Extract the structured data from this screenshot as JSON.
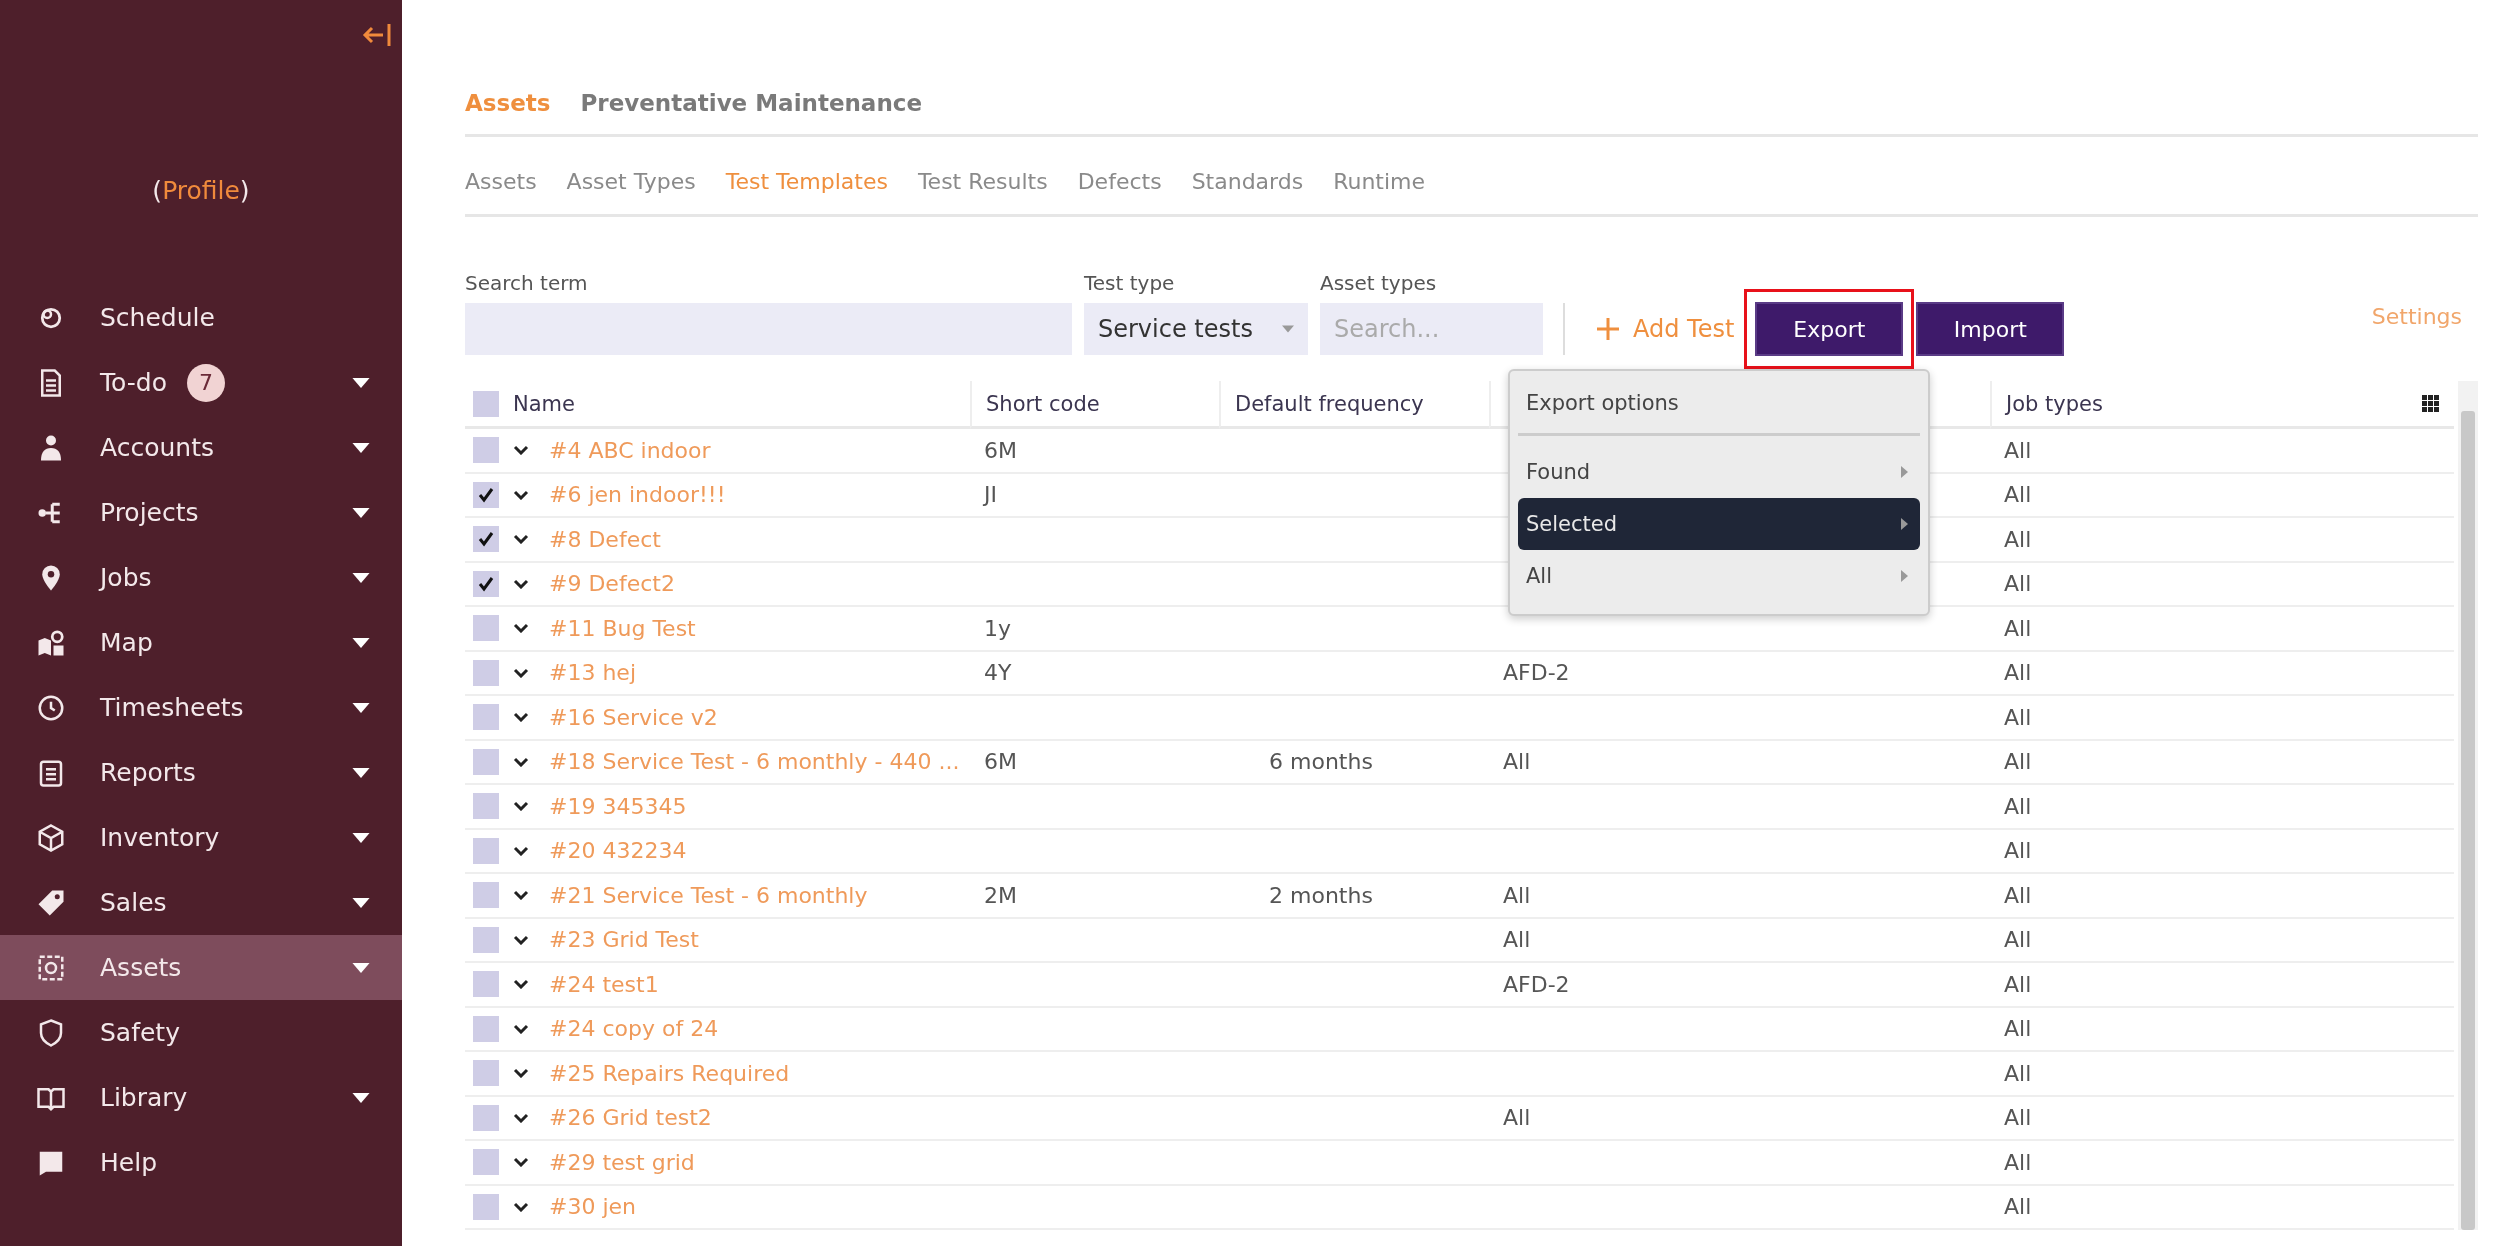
{
  "sidebar": {
    "profile": {
      "prefix": "(",
      "link": "Profile",
      "suffix": ")"
    },
    "items": [
      {
        "label": "Schedule",
        "expandable": false,
        "selected": false
      },
      {
        "label": "To-do",
        "badge": "7",
        "expandable": true,
        "selected": false
      },
      {
        "label": "Accounts",
        "expandable": true,
        "selected": false
      },
      {
        "label": "Projects",
        "expandable": true,
        "selected": false
      },
      {
        "label": "Jobs",
        "expandable": true,
        "selected": false
      },
      {
        "label": "Map",
        "expandable": true,
        "selected": false
      },
      {
        "label": "Timesheets",
        "expandable": true,
        "selected": false
      },
      {
        "label": "Reports",
        "expandable": true,
        "selected": false
      },
      {
        "label": "Inventory",
        "expandable": true,
        "selected": false
      },
      {
        "label": "Sales",
        "expandable": true,
        "selected": false
      },
      {
        "label": "Assets",
        "expandable": true,
        "selected": true
      },
      {
        "label": "Safety",
        "expandable": false,
        "selected": false
      },
      {
        "label": "Library",
        "expandable": true,
        "selected": false
      },
      {
        "label": "Help",
        "expandable": false,
        "selected": false
      }
    ]
  },
  "section_tabs": [
    {
      "label": "Assets",
      "selected": true
    },
    {
      "label": "Preventative Maintenance",
      "selected": false
    }
  ],
  "sub_tabs": [
    {
      "label": "Assets",
      "selected": false
    },
    {
      "label": "Asset Types",
      "selected": false
    },
    {
      "label": "Test Templates",
      "selected": true
    },
    {
      "label": "Test Results",
      "selected": false
    },
    {
      "label": "Defects",
      "selected": false
    },
    {
      "label": "Standards",
      "selected": false
    },
    {
      "label": "Runtime",
      "selected": false
    }
  ],
  "filters": {
    "search_term": {
      "label": "Search term"
    },
    "test_type": {
      "label": "Test type",
      "value": "Service tests"
    },
    "asset_types": {
      "label": "Asset types",
      "placeholder": "Search..."
    }
  },
  "toolbar": {
    "add_test": "Add Test",
    "export": "Export",
    "import": "Import",
    "settings": "Settings"
  },
  "export_menu": {
    "title": "Export options",
    "items": [
      {
        "label": "Found",
        "selected": false
      },
      {
        "label": "Selected",
        "selected": true
      },
      {
        "label": "All",
        "selected": false
      }
    ]
  },
  "table": {
    "columns": [
      "Name",
      "Short code",
      "Default frequency",
      "Job types"
    ],
    "header_checked": false,
    "rows": [
      {
        "checked": false,
        "name": "#4 ABC indoor",
        "short_code": "6M",
        "job_types": "All"
      },
      {
        "checked": true,
        "name": "#6 jen indoor!!!",
        "short_code": "JI",
        "job_types": "All"
      },
      {
        "checked": true,
        "name": "#8 Defect",
        "job_types": "All"
      },
      {
        "checked": true,
        "name": "#9 Defect2",
        "job_types": "All"
      },
      {
        "checked": false,
        "name": "#11 Bug Test",
        "short_code": "1y",
        "job_types": "All"
      },
      {
        "checked": false,
        "name": "#13 hej",
        "short_code": "4Y",
        "column_4": "AFD-2",
        "job_types": "All"
      },
      {
        "checked": false,
        "name": "#16 Service v2",
        "job_types": "All"
      },
      {
        "checked": false,
        "name": "#18 Service Test - 6 monthly - 440 ...",
        "short_code": "6M",
        "default_frequency": "6 months",
        "column_4": "All",
        "job_types": "All"
      },
      {
        "checked": false,
        "name": "#19 345345",
        "job_types": "All"
      },
      {
        "checked": false,
        "name": "#20 432234",
        "job_types": "All"
      },
      {
        "checked": false,
        "name": "#21 Service Test - 6 monthly",
        "short_code": "2M",
        "default_frequency": "2 months",
        "column_4": "All",
        "job_types": "All"
      },
      {
        "checked": false,
        "name": "#23 Grid Test",
        "column_4": "All",
        "job_types": "All"
      },
      {
        "checked": false,
        "name": "#24 test1",
        "column_4": "AFD-2",
        "job_types": "All"
      },
      {
        "checked": false,
        "name": "#24 copy of 24",
        "job_types": "All"
      },
      {
        "checked": false,
        "name": "#25 Repairs Required",
        "job_types": "All"
      },
      {
        "checked": false,
        "name": "#26 Grid test2",
        "column_4": "All",
        "job_types": "All"
      },
      {
        "checked": false,
        "name": "#29 test grid",
        "job_types": "All"
      },
      {
        "checked": false,
        "name": "#30 jen",
        "job_types": "All"
      }
    ]
  }
}
